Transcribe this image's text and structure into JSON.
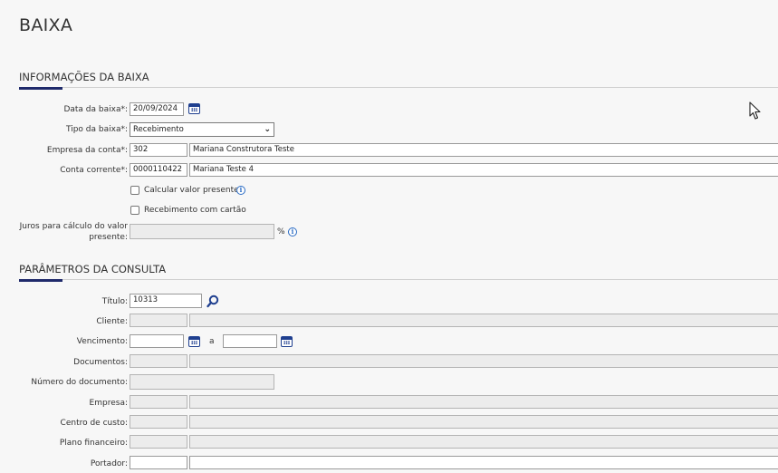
{
  "page": {
    "title": "BAIXA"
  },
  "info_section": {
    "title": "INFORMAÇÕES DA BAIXA",
    "data_baixa": {
      "label": "Data da baixa*:",
      "value": "20/09/2024"
    },
    "tipo_baixa": {
      "label": "Tipo da baixa*:",
      "value": "Recebimento"
    },
    "empresa_conta": {
      "label": "Empresa da conta*:",
      "code": "302",
      "name": "Mariana Construtora Teste"
    },
    "conta_corrente": {
      "label": "Conta corrente*:",
      "code": "0000110422",
      "name": "Mariana Teste 4"
    },
    "calcular_valor_presente": {
      "label": "Calcular valor presente",
      "checked": false
    },
    "recebimento_cartao": {
      "label": "Recebimento com cartão",
      "checked": false
    },
    "juros": {
      "label_line1": "Juros para cálculo do valor",
      "label_line2": "presente:",
      "unit": "%"
    }
  },
  "query_section": {
    "title": "PARÂMETROS DA CONSULTA",
    "titulo": {
      "label": "Título:",
      "value": "10313"
    },
    "cliente": {
      "label": "Cliente:"
    },
    "vencimento": {
      "label": "Vencimento:",
      "separator": "a"
    },
    "documentos": {
      "label": "Documentos:"
    },
    "numero_documento": {
      "label": "Número do documento:"
    },
    "empresa": {
      "label": "Empresa:"
    },
    "centro_custo": {
      "label": "Centro de custo:"
    },
    "plano_financeiro": {
      "label": "Plano financeiro:"
    },
    "portador": {
      "label": "Portador:"
    }
  },
  "icons": {
    "calendar": "calendar-icon",
    "info": "info-icon",
    "search": "search-icon",
    "cursor": "mouse-cursor-icon",
    "chevron": "chevron-down-icon"
  },
  "colors": {
    "accent": "#1f2a6b",
    "icon_blue": "#1f3f8f",
    "readonly_bg": "#ececec"
  }
}
